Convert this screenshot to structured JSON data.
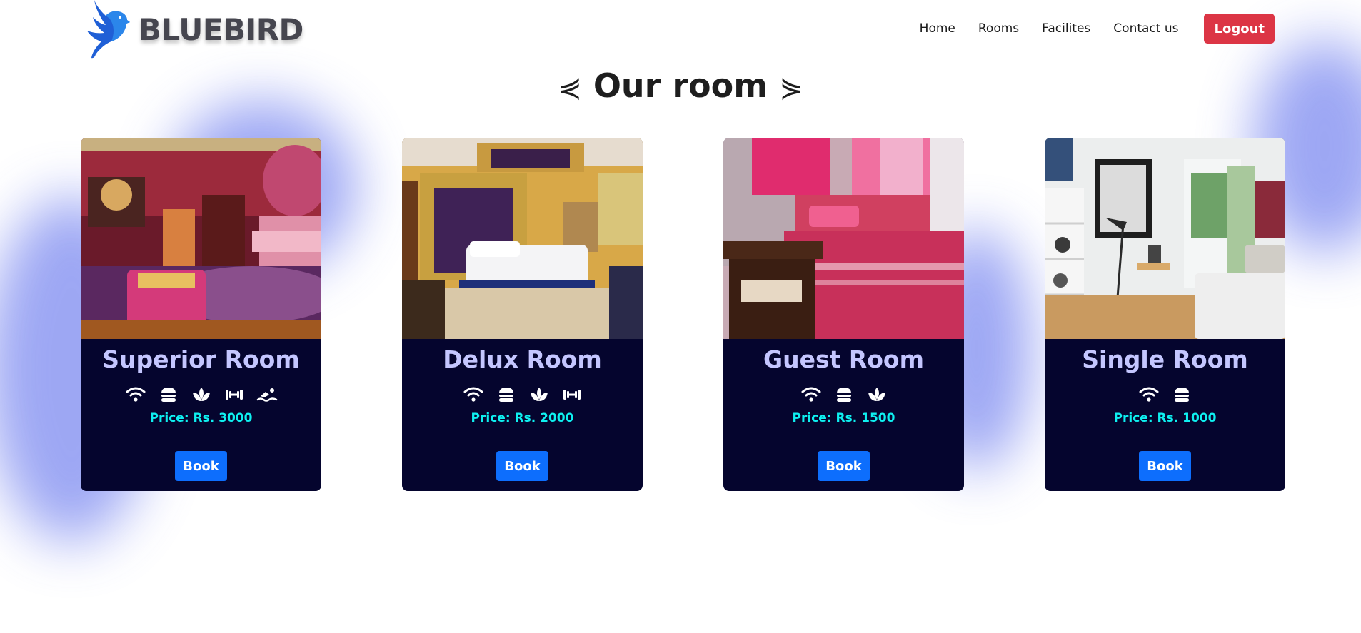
{
  "brand": {
    "name": "BLUEBIRD"
  },
  "nav": {
    "links": [
      "Home",
      "Rooms",
      "Facilites",
      "Contact us"
    ],
    "logout_label": "Logout"
  },
  "section": {
    "title": "Our room",
    "deco_left": "⋞",
    "deco_right": "⋟"
  },
  "colors": {
    "card_bg": "#05052e",
    "title": "#c4c6ff",
    "price": "#0ef0f0",
    "book_button": "#0d6efd",
    "logout_button": "#dc3545",
    "blob": "#8c98f2"
  },
  "rooms": [
    {
      "name": "Superior Room",
      "amenities": [
        "wifi-icon",
        "burger-icon",
        "spa-icon",
        "gym-icon",
        "swim-icon"
      ],
      "price": "Price: Rs. 3000",
      "book_label": "Book"
    },
    {
      "name": "Delux Room",
      "amenities": [
        "wifi-icon",
        "burger-icon",
        "spa-icon",
        "gym-icon"
      ],
      "price": "Price: Rs. 2000",
      "book_label": "Book"
    },
    {
      "name": "Guest Room",
      "amenities": [
        "wifi-icon",
        "burger-icon",
        "spa-icon"
      ],
      "price": "Price: Rs. 1500",
      "book_label": "Book"
    },
    {
      "name": "Single Room",
      "amenities": [
        "wifi-icon",
        "burger-icon"
      ],
      "price": "Price: Rs. 1000",
      "book_label": "Book"
    }
  ]
}
